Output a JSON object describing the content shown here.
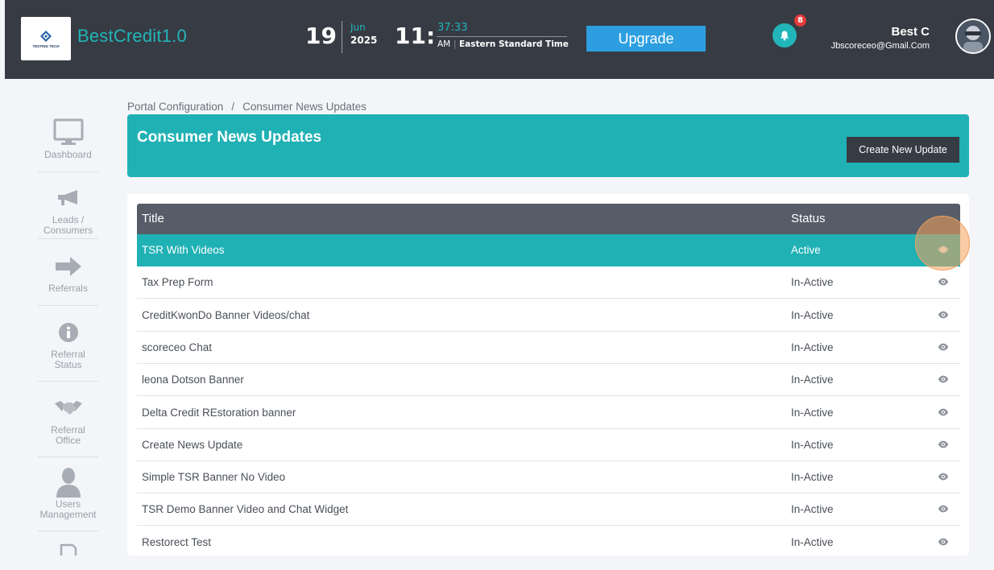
{
  "header": {
    "brand": "BestCredit1.0",
    "logo_text": "TESTING TECH",
    "date_day": "19",
    "date_month": "Jun",
    "date_year": "2025",
    "time_hour": "11:",
    "time_seconds": "37:33",
    "time_ampm": "AM",
    "time_zone": "Eastern Standard Time",
    "upgrade_label": "Upgrade",
    "notification_count": "8",
    "user_name": "Best C",
    "user_email": "Jbscoreceo@Gmail.Com"
  },
  "sidebar": {
    "items": [
      {
        "label": "Dashboard",
        "icon": "monitor-icon"
      },
      {
        "label": "Leads /\nConsumers",
        "icon": "megaphone-icon"
      },
      {
        "label": "Referrals",
        "icon": "arrow-right-icon"
      },
      {
        "label": "Referral\nStatus",
        "icon": "info-icon"
      },
      {
        "label": "Referral\nOffice",
        "icon": "handshake-icon"
      },
      {
        "label": "Users\nManagement",
        "icon": "user-icon"
      }
    ]
  },
  "breadcrumb": {
    "parent": "Portal Configuration",
    "separator": "/",
    "current": "Consumer News Updates"
  },
  "page": {
    "title": "Consumer News Updates",
    "create_button": "Create New Update"
  },
  "table": {
    "headers": {
      "title": "Title",
      "status": "Status"
    },
    "rows": [
      {
        "title": "TSR With Videos",
        "status": "Active"
      },
      {
        "title": "Tax Prep Form",
        "status": "In-Active"
      },
      {
        "title": "CreditKwonDo Banner Videos/chat",
        "status": "In-Active"
      },
      {
        "title": "scoreceo Chat",
        "status": "In-Active"
      },
      {
        "title": "leona Dotson Banner",
        "status": "In-Active"
      },
      {
        "title": "Delta Credit REstoration banner",
        "status": "In-Active"
      },
      {
        "title": "Create News Update",
        "status": "In-Active"
      },
      {
        "title": "Simple TSR Banner No Video",
        "status": "In-Active"
      },
      {
        "title": "TSR Demo Banner Video and Chat Widget",
        "status": "In-Active"
      },
      {
        "title": "Restorect Test",
        "status": "In-Active"
      }
    ]
  },
  "colors": {
    "accent": "#20b1b5",
    "header_bg": "#373b44",
    "table_header_bg": "#565d69",
    "upgrade_bg": "#2d9fe0"
  }
}
